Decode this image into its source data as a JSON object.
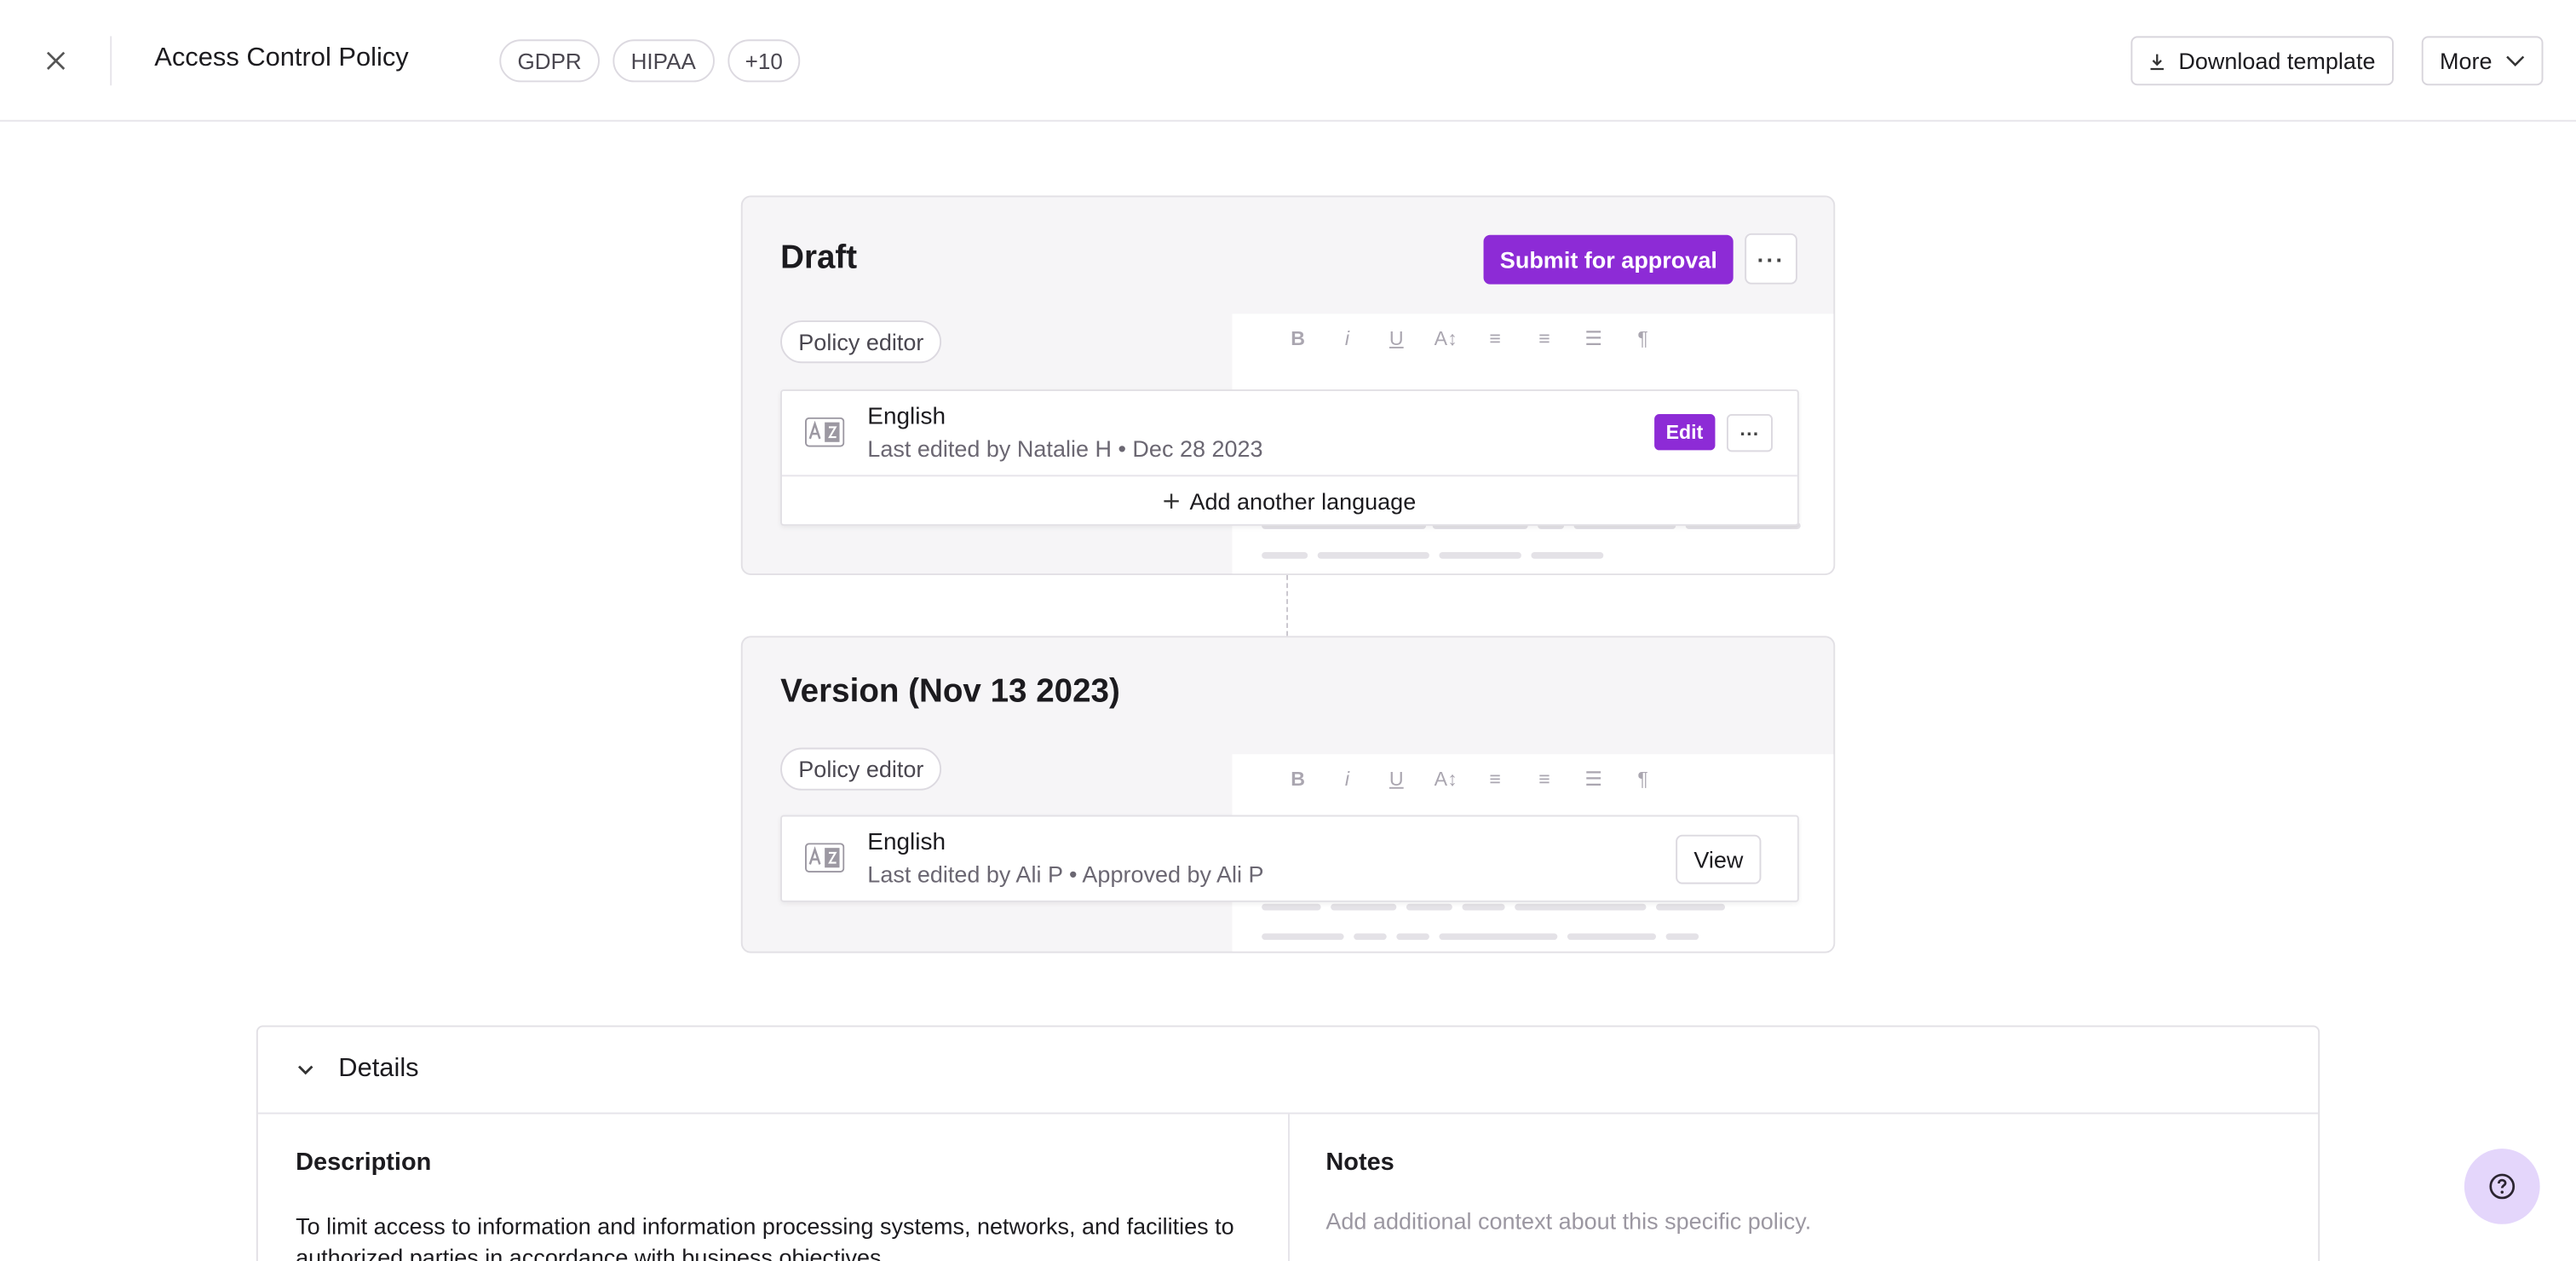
{
  "header": {
    "title": "Access Control Policy",
    "tags": [
      "GDPR",
      "HIPAA",
      "+10"
    ],
    "download_label": "Download template",
    "more_label": "More"
  },
  "draft": {
    "title": "Draft",
    "submit_label": "Submit for approval",
    "pill": "Policy editor",
    "language": "English",
    "meta": "Last edited by Natalie H • Dec 28 2023",
    "edit_label": "Edit",
    "add_language_label": "Add another language"
  },
  "version": {
    "title": "Version (Nov 13 2023)",
    "pill": "Policy editor",
    "language": "English",
    "meta": "Last edited by Ali P • Approved by Ali P",
    "view_label": "View"
  },
  "details": {
    "title": "Details",
    "description_label": "Description",
    "description_text": "To limit access to information and information processing systems, networks, and facilities to authorized parties in accordance with business objectives.",
    "notes_label": "Notes",
    "notes_placeholder": "Add additional context about this specific policy."
  },
  "colors": {
    "accent": "#8d2bd6",
    "help_bg": "#e4d6fb"
  }
}
